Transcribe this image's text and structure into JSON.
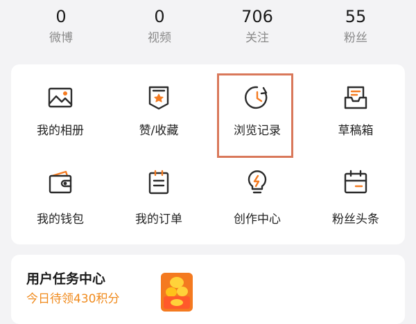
{
  "stats": [
    {
      "value": "0",
      "label": "微博"
    },
    {
      "value": "0",
      "label": "视频"
    },
    {
      "value": "706",
      "label": "关注"
    },
    {
      "value": "55",
      "label": "粉丝"
    }
  ],
  "grid": {
    "items": [
      {
        "label": "我的相册",
        "icon": "photo-album-icon"
      },
      {
        "label": "赞/收藏",
        "icon": "favorites-badge-icon"
      },
      {
        "label": "浏览记录",
        "icon": "history-clock-icon"
      },
      {
        "label": "草稿箱",
        "icon": "drafts-tray-icon"
      },
      {
        "label": "我的钱包",
        "icon": "wallet-icon"
      },
      {
        "label": "我的订单",
        "icon": "order-clipboard-icon"
      },
      {
        "label": "创作中心",
        "icon": "lightbulb-icon"
      },
      {
        "label": "粉丝头条",
        "icon": "calendar-card-icon"
      }
    ]
  },
  "task": {
    "title": "用户任务中心",
    "subtitle": "今日待领430积分",
    "badge_icon": "coin-gift-icon"
  },
  "colors": {
    "accent_orange": "#f08a1c",
    "icon_orange": "#f47a20",
    "highlight_border": "#d9785a",
    "background": "#f3f3f5"
  }
}
